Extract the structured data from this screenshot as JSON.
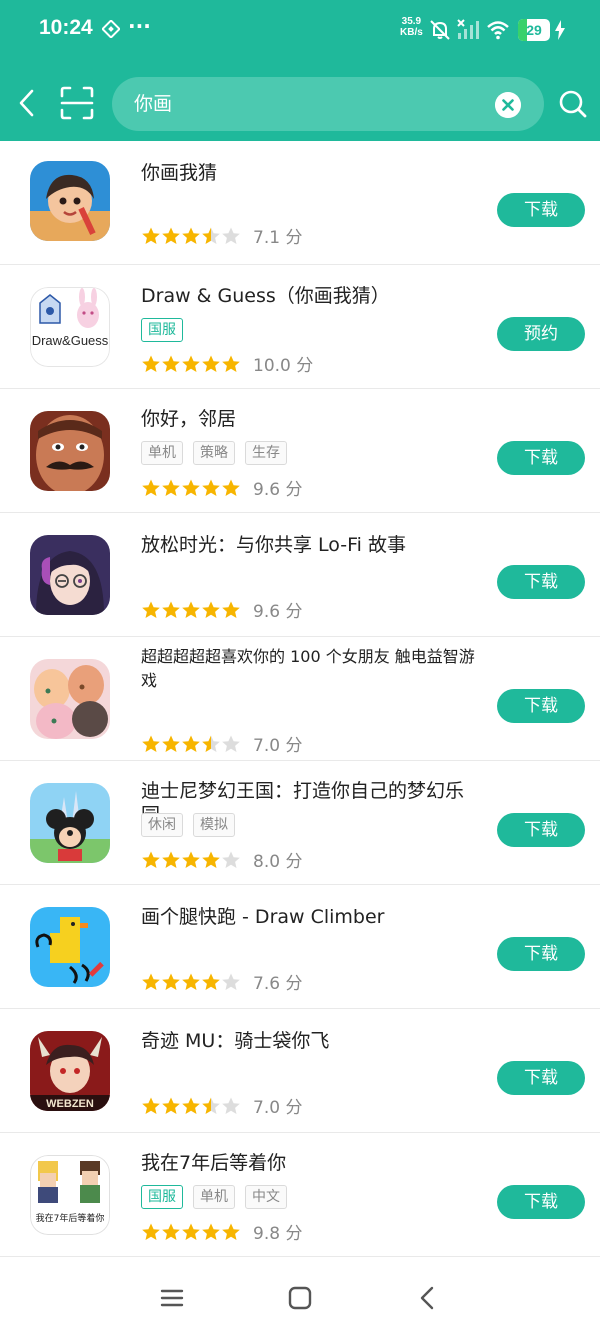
{
  "status_bar": {
    "time": "10:24",
    "extra": "···",
    "net_speed_value": "35.9",
    "net_speed_unit": "KB/s",
    "battery": "29",
    "battery_level": 0.29
  },
  "search": {
    "query": "你画",
    "placeholder": ""
  },
  "colors": {
    "accent": "#1fb99b",
    "star": "#f7b500",
    "star_empty": "#dddddd"
  },
  "apps": [
    {
      "name": "你画我猜",
      "tags": [],
      "rating": 3.5,
      "score": "7.1 分",
      "button": "下载"
    },
    {
      "name": "Draw & Guess（你画我猜）",
      "tags": [
        "国服"
      ],
      "rating": 5,
      "score": "10.0 分",
      "button": "预约"
    },
    {
      "name": "你好，邻居",
      "tags": [
        "单机",
        "策略",
        "生存"
      ],
      "rating": 5,
      "score": "9.6 分",
      "button": "下载"
    },
    {
      "name": "放松时光：与你共享 Lo-Fi 故事",
      "tags": [],
      "rating": 5,
      "score": "9.6 分",
      "button": "下载"
    },
    {
      "name": "超超超超超喜欢你的 100 个女朋友 触电益智游戏",
      "tags": [],
      "rating": 3.5,
      "score": "7.0 分",
      "button": "下载"
    },
    {
      "name": "迪士尼梦幻王国：打造你自己的梦幻乐园",
      "tags": [
        "休闲",
        "模拟"
      ],
      "rating": 4,
      "score": "8.0 分",
      "button": "下载"
    },
    {
      "name": "画个腿快跑 - Draw Climber",
      "tags": [],
      "rating": 4,
      "score": "7.6 分",
      "button": "下载"
    },
    {
      "name": "奇迹 MU：骑士袋你飞",
      "tags": [],
      "rating": 3.5,
      "score": "7.0 分",
      "button": "下载"
    },
    {
      "name": "我在7年后等着你",
      "tags": [
        "国服",
        "单机",
        "中文"
      ],
      "rating": 5,
      "score": "9.8 分",
      "button": "下载"
    }
  ],
  "icon_texts": {
    "draw_guess": "Draw&Guess",
    "webzen": "WEBZEN",
    "seven_years": "我在7年后等着你"
  }
}
